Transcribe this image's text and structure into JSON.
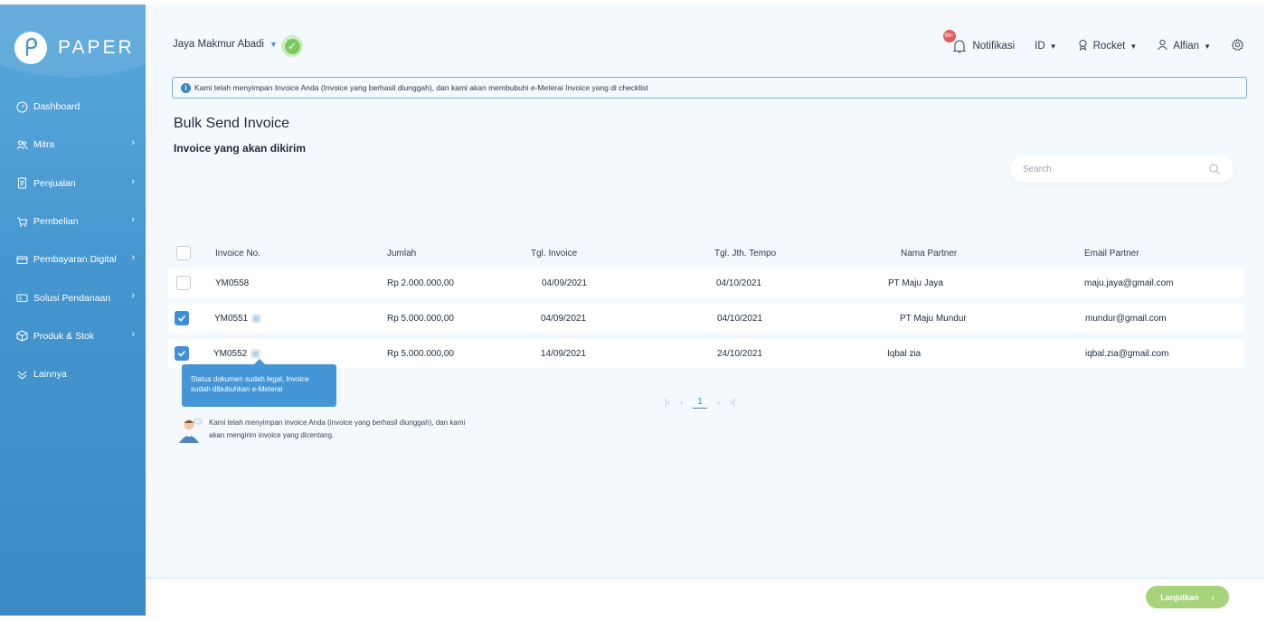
{
  "brand": {
    "name": "PAPER"
  },
  "sidebar": {
    "items": [
      {
        "label": "Dashboard",
        "icon": "dashboard-icon",
        "has_children": false
      },
      {
        "label": "Mitra",
        "icon": "partners-icon",
        "has_children": true
      },
      {
        "label": "Penjualan",
        "icon": "sales-document-icon",
        "has_children": true
      },
      {
        "label": "Pembelian",
        "icon": "cart-icon",
        "has_children": true
      },
      {
        "label": "Pembayaran Digital",
        "icon": "card-payment-icon",
        "has_children": true
      },
      {
        "label": "Solusi Pendanaan",
        "icon": "funding-icon",
        "has_children": true
      },
      {
        "label": "Produk & Stok",
        "icon": "box-icon",
        "has_children": true
      },
      {
        "label": "Lainnya",
        "icon": "more-icon",
        "has_children": false
      }
    ]
  },
  "header": {
    "company": "Jaya Makmur Abadi",
    "notif_count": "99+",
    "notif_label": "Notifikasi",
    "lang": "ID",
    "plan": "Rocket",
    "user": "Alfian"
  },
  "banner": {
    "text": "Kami telah menyimpan Invoice Anda (Invoice yang berhasil diunggah), dan kami akan membubuhi e-Meterai Invoice yang di checklist"
  },
  "page": {
    "title": "Bulk Send Invoice",
    "subtitle": "Invoice yang akan dikirim"
  },
  "search": {
    "placeholder": "Search"
  },
  "table": {
    "headers": [
      "Invoice No.",
      "Jumlah",
      "Tgl. Invoice",
      "Tgl. Jth. Tempo",
      "Nama Partner",
      "Email Partner"
    ],
    "rows": [
      {
        "invoice": "YM0558",
        "jumlah": "Rp 2.000.000,00",
        "tgl_invoice": "04/09/2021",
        "jatuh_tempo": "04/10/2021",
        "partner": "PT Maju Jaya",
        "email": "maju.jaya@gmail.com",
        "checked": false,
        "stamped": false
      },
      {
        "invoice": "YM0551",
        "jumlah": "Rp 5.000.000,00",
        "tgl_invoice": "04/09/2021",
        "jatuh_tempo": "04/10/2021",
        "partner": "PT Maju Mundur",
        "email": "mundur@gmail.com",
        "checked": true,
        "stamped": true
      },
      {
        "invoice": "YM0552",
        "jumlah": "Rp 5.000.000,00",
        "tgl_invoice": "14/09/2021",
        "jatuh_tempo": "24/10/2021",
        "partner": "Iqbal zia",
        "email": "iqbal.zia@gmail.com",
        "checked": true,
        "stamped": true
      }
    ]
  },
  "tooltip": {
    "text": "Status dokumen sudah legal, Invoice sudah dibubuhkan e-Meterai"
  },
  "pagination": {
    "current": "1"
  },
  "assistant": {
    "text": "Kami telah menyimpan invoice Anda (invoice yang berhasil diunggah), dan kami akan mengirim invoice yang dicentang."
  },
  "footer": {
    "cta_label": "Lanjutkan"
  },
  "colors": {
    "sidebar": "#4596cf",
    "accent": "#3f8fd8",
    "cta": "#a7d37a",
    "main_bg": "#f3f9fd",
    "badge": "#e65b5b"
  }
}
